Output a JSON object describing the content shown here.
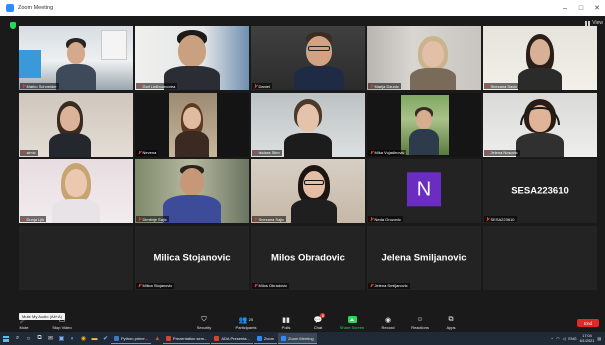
{
  "window": {
    "title": "Zoom Meeting",
    "controls": [
      "–",
      "□",
      "✕"
    ]
  },
  "meeting": {
    "view_label": "View",
    "tooltip": "Mute My Audio (Alt+A)",
    "participants": [
      {
        "name": "Marko Schneider",
        "muted": true,
        "type": "video"
      },
      {
        "name": "Goli Ledbuurcorea",
        "muted": true,
        "type": "video",
        "active_speaker": true
      },
      {
        "name": "Daniel",
        "muted": true,
        "type": "video"
      },
      {
        "name": "Marija Dzunic",
        "muted": true,
        "type": "video"
      },
      {
        "name": "Snezana Savic",
        "muted": true,
        "type": "video"
      },
      {
        "name": "simic",
        "muted": true,
        "type": "video"
      },
      {
        "name": "Nevena",
        "muted": true,
        "type": "video"
      },
      {
        "name": "Isidora Stim",
        "muted": true,
        "type": "video"
      },
      {
        "name": "Mika Vujadinovic",
        "muted": true,
        "type": "video"
      },
      {
        "name": "Jelena Nosovic",
        "muted": true,
        "type": "video"
      },
      {
        "name": "Dunja Ljik",
        "muted": true,
        "type": "video"
      },
      {
        "name": "Dimitrije Sajic",
        "muted": true,
        "type": "video"
      },
      {
        "name": "Snezana Sajic",
        "muted": true,
        "type": "video"
      },
      {
        "name": "Neda Orozovic",
        "muted": true,
        "type": "avatar",
        "initial": "N"
      },
      {
        "name": "SESA223610",
        "muted": true,
        "type": "text",
        "display": "SESA223610"
      },
      {
        "name": "",
        "type": "empty"
      },
      {
        "name": "Milica Stojanovic",
        "muted": true,
        "type": "text",
        "display": "Milica Stojanovic"
      },
      {
        "name": "Milos Obradovic",
        "muted": true,
        "type": "text",
        "display": "Milos Obradovic"
      },
      {
        "name": "Jelena Smiljanovic",
        "muted": true,
        "type": "text",
        "display": "Jelena Smiljanovic"
      },
      {
        "name": "",
        "type": "empty"
      }
    ]
  },
  "toolbar": {
    "unmute_label": "Mute",
    "stop_video_label": "Stop Video",
    "security_label": "Security",
    "participants_label": "Participants",
    "participants_count": "25",
    "polls_label": "Polls",
    "chat_label": "Chat",
    "chat_badge": "8",
    "share_label": "Share Screen",
    "record_label": "Record",
    "reactions_label": "Reactions",
    "apps_label": "Apps",
    "end_label": "End"
  },
  "taskbar": {
    "apps": [
      {
        "label": "Python prime...",
        "color": "#3b78c8"
      },
      {
        "label": "Prezentation sem...",
        "color": "#d24726"
      },
      {
        "label": "ADA Presenta...",
        "color": "#d24726"
      },
      {
        "label": "Zoom",
        "color": "#2D8CFF"
      },
      {
        "label": "Zoom Meeting",
        "color": "#2D8CFF",
        "active": true
      }
    ],
    "tray_text": "ENG",
    "time": "17:04",
    "date": "6/1/2021"
  },
  "colors": {
    "active_speaker": "#c8e85a",
    "avatar_bg": "#6a2cc1",
    "end_button": "#e02828",
    "share_green": "#23d959"
  }
}
